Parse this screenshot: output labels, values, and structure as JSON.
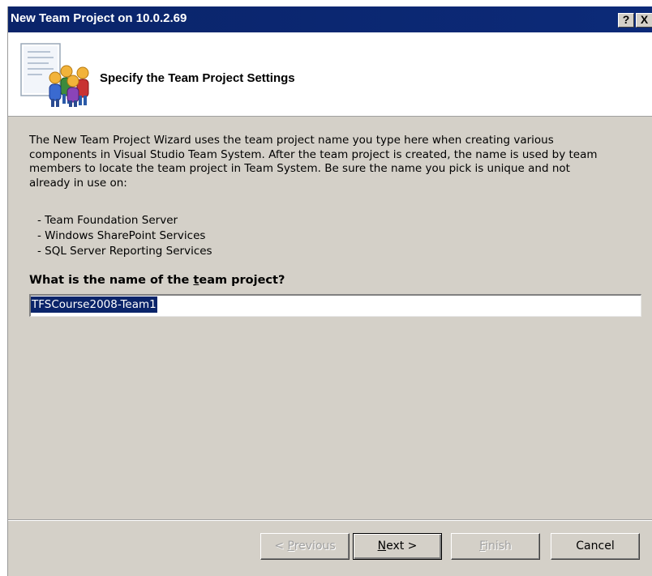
{
  "window": {
    "title": "New Team Project on 10.0.2.69",
    "help_glyph": "?",
    "close_glyph": "X"
  },
  "header": {
    "title": "Specify the Team Project Settings",
    "icon": "team-project-icon"
  },
  "content": {
    "description": "The New Team Project Wizard uses the team project name you type here when creating various components in Visual Studio Team System.  After the team project is created, the name is used by team members to locate the team project in Team System.  Be sure the name you pick is unique and not already in use on:",
    "services": [
      "- Team Foundation Server",
      "- Windows SharePoint Services",
      "- SQL Server Reporting Services"
    ],
    "question_pre": "What is the name of the ",
    "question_accel": "t",
    "question_post": "eam project?",
    "project_name": "TFSCourse2008-Team1"
  },
  "buttons": {
    "previous_pre": "< ",
    "previous_accel": "P",
    "previous_post": "revious",
    "next_accel": "N",
    "next_post": "ext >",
    "finish_accel": "F",
    "finish_post": "inish",
    "cancel": "Cancel"
  },
  "colors": {
    "titlebar": "#0a246a",
    "dialog_face": "#d4d0c8",
    "selection": "#0a246a"
  }
}
